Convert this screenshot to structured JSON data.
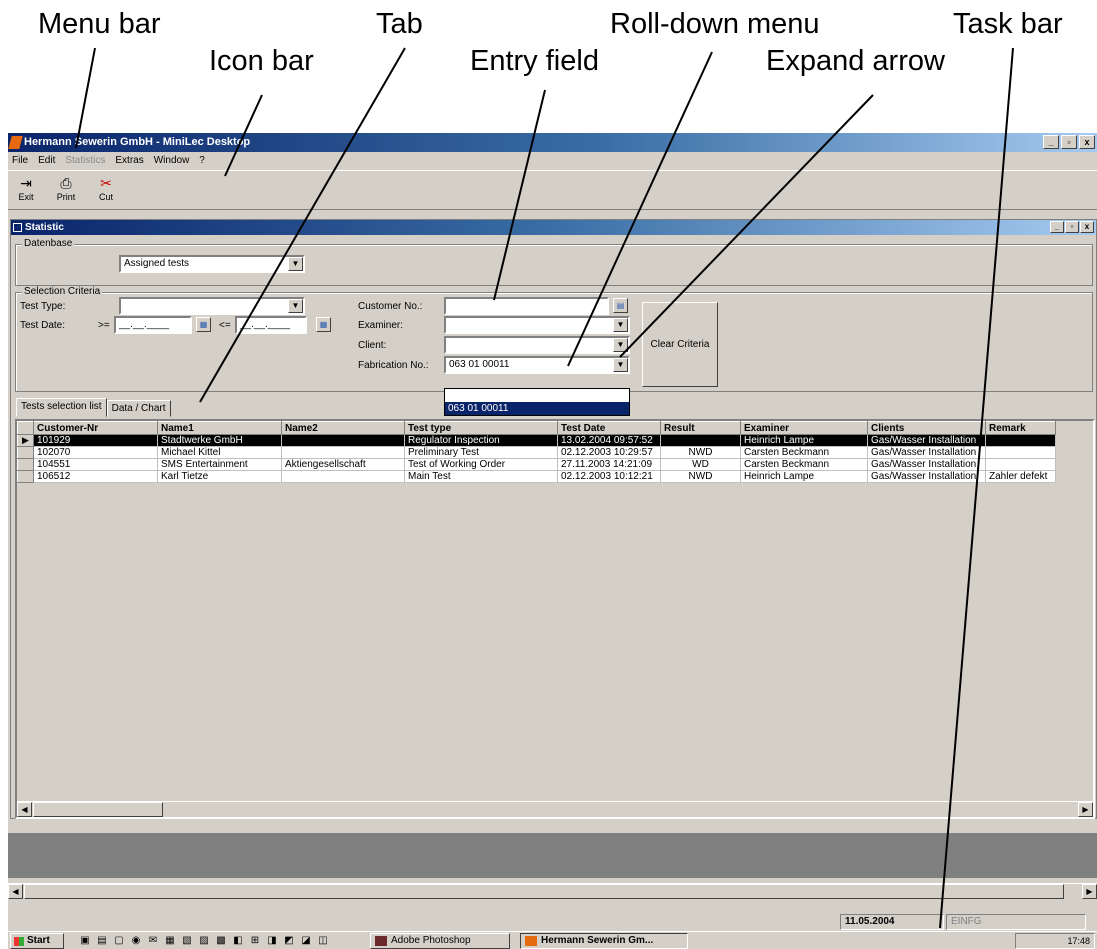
{
  "annotations": {
    "menu_bar": "Menu bar",
    "icon_bar": "Icon bar",
    "tab": "Tab",
    "entry_field": "Entry field",
    "roll_down_menu": "Roll-down menu",
    "expand_arrow": "Expand arrow",
    "task_bar": "Task bar"
  },
  "app": {
    "title": "Hermann Sewerin GmbH - MiniLec Desktop",
    "menu": [
      "File",
      "Edit",
      "Statistics",
      "Extras",
      "Window",
      "?"
    ],
    "toolbar": [
      "Exit",
      "Print",
      "Cut"
    ]
  },
  "child": {
    "title": "Statistic",
    "database_label": "Datenbase",
    "database_value": "Assigned tests",
    "criteria_label": "Selection Criteria",
    "test_type_label": "Test Type:",
    "test_date_label": "Test Date:",
    "from_op": ">=",
    "to_op": "<=",
    "date_placeholder": "__.__.____",
    "customer_label": "Customer No.:",
    "examiner_label": "Examiner:",
    "client_label": "Client:",
    "fabrication_label": "Fabrication No.:",
    "fabrication_value": "063 01 00011",
    "dropdown_option": "063 01 00011",
    "clear_button": "Clear Criteria",
    "tabs": [
      "Tests selection list",
      "Data / Chart"
    ]
  },
  "table": {
    "columns": [
      "Customer-Nr",
      "Name1",
      "Name2",
      "Test type",
      "Test Date",
      "Result",
      "Examiner",
      "Clients",
      "Remark"
    ],
    "rows": [
      [
        "101929",
        "Stadtwerke GmbH",
        "",
        "Regulator Inspection",
        "13.02.2004 09:57:52",
        "",
        "Heinrich Lampe",
        "Gas/Wasser Installation",
        ""
      ],
      [
        "102070",
        "Michael Kittel",
        "",
        "Preliminary Test",
        "02.12.2003 10:29:57",
        "NWD",
        "Carsten Beckmann",
        "Gas/Wasser Installation",
        ""
      ],
      [
        "104551",
        "SMS Entertainment",
        "Aktiengesellschaft",
        "Test of Working Order",
        "27.11.2003 14:21:09",
        "WD",
        "Carsten Beckmann",
        "Gas/Wasser Installation",
        ""
      ],
      [
        "106512",
        "Karl Tietze",
        "",
        "Main Test",
        "02.12.2003 10:12:21",
        "NWD",
        "Heinrich Lampe",
        "Gas/Wasser Installation",
        "Zahler defekt"
      ]
    ]
  },
  "status": {
    "date": "11.05.2004",
    "mode": "EINFG"
  },
  "taskbar": {
    "start": "Start",
    "buttons": [
      "Adobe Photoshop",
      "Hermann Sewerin Gm..."
    ],
    "clock": "17:48"
  },
  "colors": {
    "title_gradient_start": "#0a246a",
    "title_gradient_end": "#a6caf0",
    "selection": "#0a246a"
  }
}
